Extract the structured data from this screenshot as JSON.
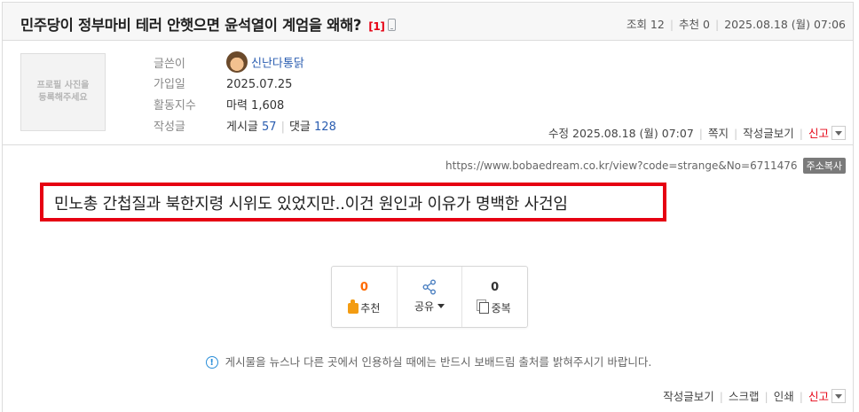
{
  "post": {
    "title": "민주당이 정부마비 테러 안햇으면 윤석열이 계엄을 왜해?",
    "comment_count": "[1]",
    "mobile_icon": "mobile-phone-icon"
  },
  "stats": {
    "views": "조회 12",
    "recommends": "추천 0",
    "datetime": "2025.08.18 (월) 07:06"
  },
  "profile": {
    "photo_placeholder_line1": "프로필 사진을",
    "photo_placeholder_line2": "등록해주세요",
    "author_label": "글쓴이",
    "author_name": "신난다통닭",
    "joined_label": "가입일",
    "joined_value": "2025.07.25",
    "activity_label": "활동지수",
    "activity_value": "마력 1,608",
    "posts_label": "작성글",
    "posts_text": "게시글",
    "posts_count": "57",
    "comments_text": "댓글",
    "comments_count": "128"
  },
  "actions_top": {
    "edited": "수정 2025.08.18 (월) 07:07",
    "message": "쪽지",
    "view_posts": "작성글보기",
    "report": "신고"
  },
  "content": {
    "url": "https://www.bobaedream.co.kr/view?code=strange&No=6711476",
    "copy_url": "주소복사",
    "text": "민노총 간첩질과 북한지령 시위도 있었지만..이건 원인과 이유가 명백한 사건임"
  },
  "votes": {
    "recommend_count": "0",
    "recommend_label": "추천",
    "share_label": "공유",
    "duplicate_count": "0",
    "duplicate_label": "중복"
  },
  "notice": "게시물을 뉴스나 다른 곳에서 인용하실 때에는 반드시 보배드림 출처를 밝혀주시기 바랍니다.",
  "actions_bottom": {
    "view_posts": "작성글보기",
    "scrap": "스크랩",
    "print": "인쇄",
    "report": "신고"
  },
  "colors": {
    "accent_red": "#e60012",
    "link_blue": "#2a5db0",
    "recommend_orange": "#ff6a00"
  }
}
